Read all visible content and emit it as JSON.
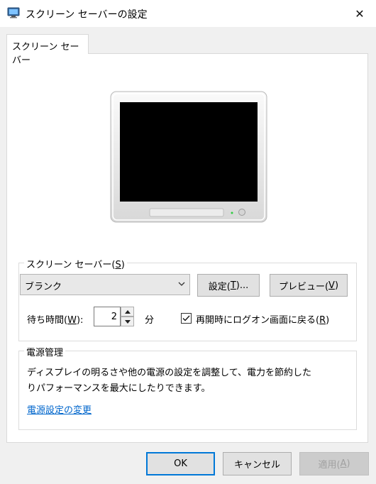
{
  "window": {
    "title": "スクリーン セーバーの設定",
    "close_glyph": "✕",
    "app_icon": "display-settings-icon",
    "close_icon": "close-icon"
  },
  "tab": {
    "label": "スクリーン セーバー"
  },
  "screensaver": {
    "legend_text": "スクリーン セーバー(",
    "legend_key": "S",
    "legend_end": ")",
    "selected": "ブランク",
    "settings_text": "設定(",
    "settings_key": "T",
    "settings_end": ")...",
    "preview_text": "プレビュー(",
    "preview_key": "V",
    "preview_end": ")",
    "wait_text": "待ち時間(",
    "wait_key": "W",
    "wait_end": "):",
    "wait_value": "2",
    "wait_unit": "分",
    "resume_text": "再開時にログオン画面に戻る(",
    "resume_key": "R",
    "resume_end": ")",
    "resume_checked": true
  },
  "power": {
    "legend": "電源管理",
    "line1": "ディスプレイの明るさや他の電源の設定を調整して、電力を節約した",
    "line2": "りパフォーマンスを最大にしたりできます。",
    "link": "電源設定の変更"
  },
  "footer": {
    "ok": "OK",
    "cancel": "キャンセル",
    "apply_text": "適用(",
    "apply_key": "A",
    "apply_end": ")"
  },
  "colors": {
    "accent": "#0078d7",
    "link": "#0066cc",
    "disabled_text": "#a0a0a0"
  }
}
